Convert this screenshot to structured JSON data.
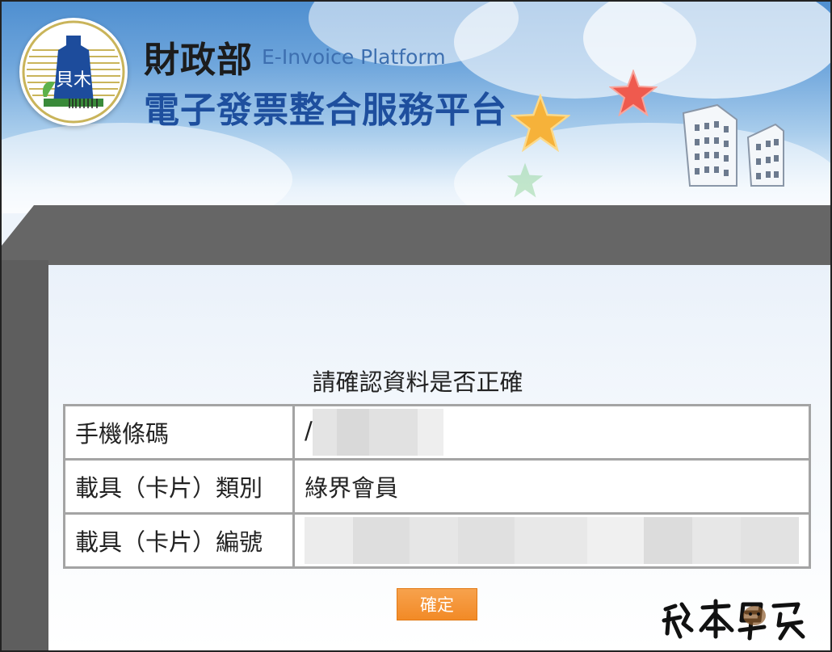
{
  "header": {
    "ministry": "財政部",
    "platform_en": "E-Invoice Platform",
    "platform_zh": "電子發票整合服務平台"
  },
  "main": {
    "heading": "請確認資料是否正確",
    "rows": [
      {
        "label": "手機條碼",
        "value": "/"
      },
      {
        "label": "載具（卡片）類別",
        "value": "綠界會員"
      },
      {
        "label": "載具（卡片）編號",
        "value": ""
      }
    ],
    "confirm_label": "確定"
  },
  "colors": {
    "sky": "#6fa6dc",
    "title_blue": "#1e4f9e",
    "panel_gray": "#666666",
    "button_orange": "#f28a26"
  },
  "icons": [
    "ministry-logo-icon",
    "star-icon",
    "building-icon",
    "signature-watermark"
  ]
}
